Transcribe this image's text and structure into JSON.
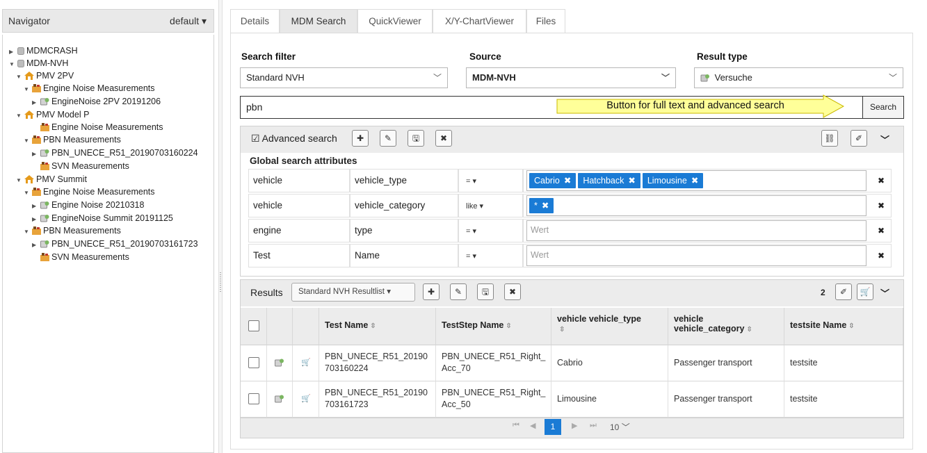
{
  "navigator": {
    "title": "Navigator",
    "profile": "default ▾",
    "tree": [
      {
        "label": "MDMCRASH",
        "arrow": "▶",
        "icon": "database-icon"
      },
      {
        "label": "MDM-NVH",
        "arrow": "▼",
        "icon": "database-icon"
      },
      {
        "label": "PMV 2PV",
        "arrow": "▼",
        "icon": "project-icon"
      },
      {
        "label": "Engine Noise Measurements",
        "arrow": "▼",
        "icon": "pool-icon"
      },
      {
        "label": "EngineNoise 2PV 20191206",
        "arrow": "▶",
        "icon": "test-icon"
      },
      {
        "label": "PMV Model P",
        "arrow": "▼",
        "icon": "project-icon"
      },
      {
        "label": "Engine Noise Measurements",
        "arrow": "",
        "icon": "pool-icon"
      },
      {
        "label": "PBN Measurements",
        "arrow": "▼",
        "icon": "pool-icon"
      },
      {
        "label": "PBN_UNECE_R51_20190703160224",
        "arrow": "▶",
        "icon": "test-icon"
      },
      {
        "label": "SVN Measurements",
        "arrow": "",
        "icon": "pool-icon"
      },
      {
        "label": "PMV Summit",
        "arrow": "▼",
        "icon": "project-icon"
      },
      {
        "label": "Engine Noise Measurements",
        "arrow": "▼",
        "icon": "pool-icon"
      },
      {
        "label": "Engine Noise 20210318",
        "arrow": "▶",
        "icon": "test-icon"
      },
      {
        "label": "EngineNoise Summit 20191125",
        "arrow": "▶",
        "icon": "test-icon"
      },
      {
        "label": "PBN Measurements",
        "arrow": "▼",
        "icon": "pool-icon"
      },
      {
        "label": "PBN_UNECE_R51_20190703161723",
        "arrow": "▶",
        "icon": "test-icon"
      },
      {
        "label": "SVN Measurements",
        "arrow": "",
        "icon": "pool-icon"
      }
    ]
  },
  "tabs": [
    "Details",
    "MDM Search",
    "QuickViewer",
    "X/Y-ChartViewer",
    "Files"
  ],
  "filters": {
    "search_filter_label": "Search filter",
    "search_filter_value": "Standard NVH",
    "source_label": "Source",
    "source_value": "MDM-NVH",
    "result_type_label": "Result type",
    "result_type_value": "Versuche"
  },
  "search": {
    "query": "pbn",
    "button": "Search",
    "callout": "Button for full text and advanced search"
  },
  "advanced": {
    "checkbox_label": "☑ Advanced search",
    "global_title": "Global search attributes",
    "rows": [
      {
        "entity": "vehicle",
        "attribute": "vehicle_type",
        "operator": "= ▾",
        "chips": [
          "Cabrio",
          "Hatchback",
          "Limousine"
        ],
        "placeholder": ""
      },
      {
        "entity": "vehicle",
        "attribute": "vehicle_category",
        "operator": "like ▾",
        "chips": [
          "*"
        ],
        "placeholder": ""
      },
      {
        "entity": "engine",
        "attribute": "type",
        "operator": "= ▾",
        "chips": [],
        "placeholder": "Wert"
      },
      {
        "entity": "Test",
        "attribute": "Name",
        "operator": "= ▾",
        "chips": [],
        "placeholder": "Wert"
      }
    ]
  },
  "results": {
    "label": "Results",
    "resultlist": "Standard NVH Resultlist ▾",
    "count": "2",
    "columns": [
      {
        "l1": "Test Name",
        "l2": ""
      },
      {
        "l1": "TestStep Name",
        "l2": ""
      },
      {
        "l1": "vehicle vehicle_type",
        "l2": ""
      },
      {
        "l1": "vehicle",
        "l2": "vehicle_category"
      },
      {
        "l1": "testsite Name",
        "l2": ""
      }
    ],
    "rows": [
      {
        "test_l1": "PBN_UNECE_R51_20190",
        "test_l2": "703160224",
        "step_l1": "PBN_UNECE_R51_Right_",
        "step_l2": "Acc_70",
        "vtype": "Cabrio",
        "vcat": "Passenger transport",
        "site": "testsite"
      },
      {
        "test_l1": "PBN_UNECE_R51_20190",
        "test_l2": "703161723",
        "step_l1": "PBN_UNECE_R51_Right_",
        "step_l2": "Acc_50",
        "vtype": "Limousine",
        "vcat": "Passenger transport",
        "site": "testsite"
      }
    ],
    "pager": {
      "current_page": "1",
      "page_size": "10"
    }
  },
  "colors": {
    "accent": "#1a7bd5",
    "callout": "#ffff99",
    "header_bg": "#ececec"
  }
}
